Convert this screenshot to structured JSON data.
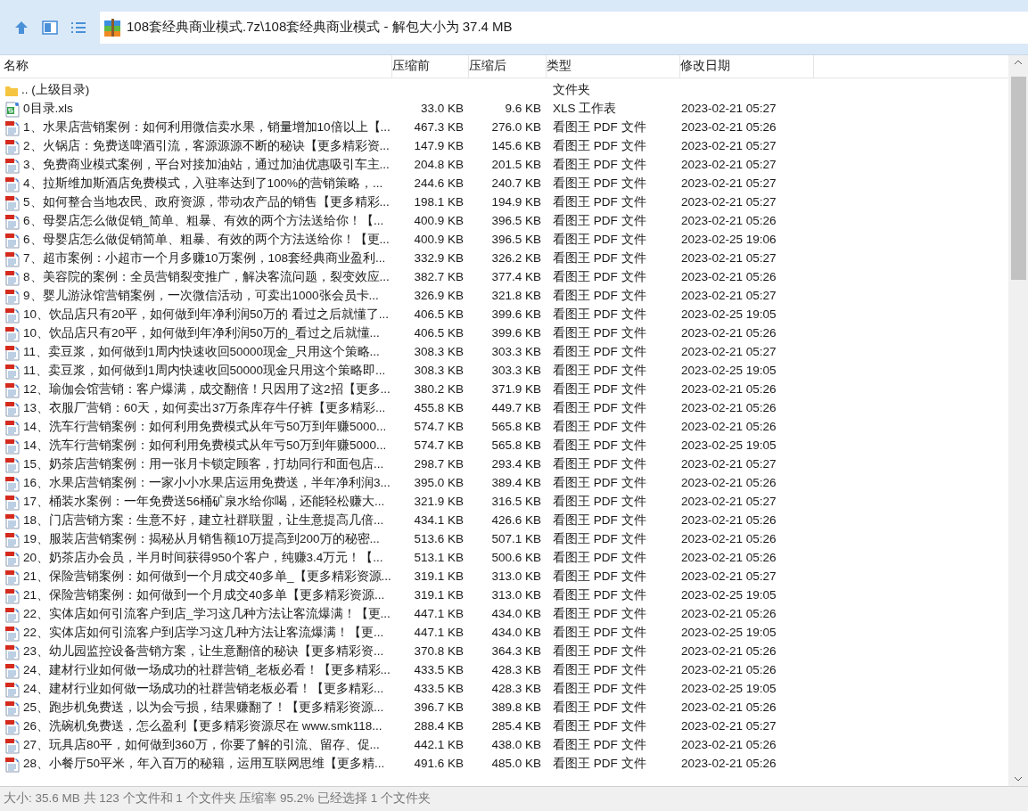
{
  "address": "108套经典商业模式.7z\\108套经典商业模式 - 解包大小为 37.4 MB",
  "columns": [
    "名称",
    "压缩前",
    "压缩后",
    "类型",
    "修改日期"
  ],
  "rows": [
    {
      "kind": "folder",
      "name": ".. (上级目录)",
      "before": "",
      "after": "",
      "type": "文件夹",
      "date": ""
    },
    {
      "kind": "xls",
      "name": "0目录.xls",
      "before": "33.0 KB",
      "after": "9.6 KB",
      "type": "XLS 工作表",
      "date": "2023-02-21 05:27"
    },
    {
      "kind": "pdf",
      "name": "1、水果店营销案例：如何利用微信卖水果，销量增加10倍以上【...",
      "before": "467.3 KB",
      "after": "276.0 KB",
      "type": "看图王 PDF 文件",
      "date": "2023-02-21 05:26"
    },
    {
      "kind": "pdf",
      "name": "2、火锅店：免费送啤酒引流，客源源源不断的秘诀【更多精彩资...",
      "before": "147.9 KB",
      "after": "145.6 KB",
      "type": "看图王 PDF 文件",
      "date": "2023-02-21 05:27"
    },
    {
      "kind": "pdf",
      "name": "3、免费商业模式案例，平台对接加油站，通过加油优惠吸引车主...",
      "before": "204.8 KB",
      "after": "201.5 KB",
      "type": "看图王 PDF 文件",
      "date": "2023-02-21 05:27"
    },
    {
      "kind": "pdf",
      "name": "4、拉斯维加斯酒店免费模式，入驻率达到了100%的营销策略，...",
      "before": "244.6 KB",
      "after": "240.7 KB",
      "type": "看图王 PDF 文件",
      "date": "2023-02-21 05:27"
    },
    {
      "kind": "pdf",
      "name": "5、如何整合当地农民、政府资源，带动农产品的销售【更多精彩...",
      "before": "198.1 KB",
      "after": "194.9 KB",
      "type": "看图王 PDF 文件",
      "date": "2023-02-21 05:27"
    },
    {
      "kind": "pdf",
      "name": "6、母婴店怎么做促销_简单、粗暴、有效的两个方法送给你！【...",
      "before": "400.9 KB",
      "after": "396.5 KB",
      "type": "看图王 PDF 文件",
      "date": "2023-02-21 05:26"
    },
    {
      "kind": "pdf",
      "name": "6、母婴店怎么做促销简单、粗暴、有效的两个方法送给你！【更...",
      "before": "400.9 KB",
      "after": "396.5 KB",
      "type": "看图王 PDF 文件",
      "date": "2023-02-25 19:06"
    },
    {
      "kind": "pdf",
      "name": "7、超市案例：小超市一个月多赚10万案例，108套经典商业盈利...",
      "before": "332.9 KB",
      "after": "326.2 KB",
      "type": "看图王 PDF 文件",
      "date": "2023-02-21 05:27"
    },
    {
      "kind": "pdf",
      "name": "8、美容院的案例：全员营销裂变推广，解决客流问题，裂变效应...",
      "before": "382.7 KB",
      "after": "377.4 KB",
      "type": "看图王 PDF 文件",
      "date": "2023-02-21 05:26"
    },
    {
      "kind": "pdf",
      "name": "9、婴儿游泳馆营销案例，一次微信活动，可卖出1000张会员卡...",
      "before": "326.9 KB",
      "after": "321.8 KB",
      "type": "看图王 PDF 文件",
      "date": "2023-02-21 05:27"
    },
    {
      "kind": "pdf",
      "name": "10、饮品店只有20平，如何做到年净利润50万的 看过之后就懂了...",
      "before": "406.5 KB",
      "after": "399.6 KB",
      "type": "看图王 PDF 文件",
      "date": "2023-02-25 19:05"
    },
    {
      "kind": "pdf",
      "name": "10、饮品店只有20平，如何做到年净利润50万的_看过之后就懂...",
      "before": "406.5 KB",
      "after": "399.6 KB",
      "type": "看图王 PDF 文件",
      "date": "2023-02-21 05:26"
    },
    {
      "kind": "pdf",
      "name": "11、卖豆浆，如何做到1周内快速收回50000现金_只用这个策略...",
      "before": "308.3 KB",
      "after": "303.3 KB",
      "type": "看图王 PDF 文件",
      "date": "2023-02-21 05:27"
    },
    {
      "kind": "pdf",
      "name": "11、卖豆浆，如何做到1周内快速收回50000现金只用这个策略即...",
      "before": "308.3 KB",
      "after": "303.3 KB",
      "type": "看图王 PDF 文件",
      "date": "2023-02-25 19:05"
    },
    {
      "kind": "pdf",
      "name": "12、瑜伽会馆营销：客户爆满，成交翻倍！只因用了这2招【更多...",
      "before": "380.2 KB",
      "after": "371.9 KB",
      "type": "看图王 PDF 文件",
      "date": "2023-02-21 05:26"
    },
    {
      "kind": "pdf",
      "name": "13、衣服厂营销：60天，如何卖出37万条库存牛仔裤【更多精彩...",
      "before": "455.8 KB",
      "after": "449.7 KB",
      "type": "看图王 PDF 文件",
      "date": "2023-02-21 05:26"
    },
    {
      "kind": "pdf",
      "name": "14、洗车行营销案例：如何利用免费模式从年亏50万到年赚5000...",
      "before": "574.7 KB",
      "after": "565.8 KB",
      "type": "看图王 PDF 文件",
      "date": "2023-02-21 05:26"
    },
    {
      "kind": "pdf",
      "name": "14、洗车行营销案例：如何利用免费模式从年亏50万到年赚5000...",
      "before": "574.7 KB",
      "after": "565.8 KB",
      "type": "看图王 PDF 文件",
      "date": "2023-02-25 19:05"
    },
    {
      "kind": "pdf",
      "name": "15、奶茶店营销案例：用一张月卡锁定顾客，打劫同行和面包店...",
      "before": "298.7 KB",
      "after": "293.4 KB",
      "type": "看图王 PDF 文件",
      "date": "2023-02-21 05:27"
    },
    {
      "kind": "pdf",
      "name": "16、水果店营销案例：一家小小水果店运用免费送，半年净利润3...",
      "before": "395.0 KB",
      "after": "389.4 KB",
      "type": "看图王 PDF 文件",
      "date": "2023-02-21 05:26"
    },
    {
      "kind": "pdf",
      "name": "17、桶装水案例：一年免费送56桶矿泉水给你喝，还能轻松赚大...",
      "before": "321.9 KB",
      "after": "316.5 KB",
      "type": "看图王 PDF 文件",
      "date": "2023-02-21 05:27"
    },
    {
      "kind": "pdf",
      "name": "18、门店营销方案：生意不好，建立社群联盟，让生意提高几倍...",
      "before": "434.1 KB",
      "after": "426.6 KB",
      "type": "看图王 PDF 文件",
      "date": "2023-02-21 05:26"
    },
    {
      "kind": "pdf",
      "name": "19、服装店营销案例：揭秘从月销售额10万提高到200万的秘密...",
      "before": "513.6 KB",
      "after": "507.1 KB",
      "type": "看图王 PDF 文件",
      "date": "2023-02-21 05:26"
    },
    {
      "kind": "pdf",
      "name": "20、奶茶店办会员，半月时间获得950个客户，纯赚3.4万元！【...",
      "before": "513.1 KB",
      "after": "500.6 KB",
      "type": "看图王 PDF 文件",
      "date": "2023-02-21 05:26"
    },
    {
      "kind": "pdf",
      "name": "21、保险营销案例：如何做到一个月成交40多单_【更多精彩资源...",
      "before": "319.1 KB",
      "after": "313.0 KB",
      "type": "看图王 PDF 文件",
      "date": "2023-02-21 05:27"
    },
    {
      "kind": "pdf",
      "name": "21、保险营销案例：如何做到一个月成交40多单【更多精彩资源...",
      "before": "319.1 KB",
      "after": "313.0 KB",
      "type": "看图王 PDF 文件",
      "date": "2023-02-25 19:05"
    },
    {
      "kind": "pdf",
      "name": "22、实体店如何引流客户到店_学习这几种方法让客流爆满！【更...",
      "before": "447.1 KB",
      "after": "434.0 KB",
      "type": "看图王 PDF 文件",
      "date": "2023-02-21 05:26"
    },
    {
      "kind": "pdf",
      "name": "22、实体店如何引流客户到店学习这几种方法让客流爆满！【更...",
      "before": "447.1 KB",
      "after": "434.0 KB",
      "type": "看图王 PDF 文件",
      "date": "2023-02-25 19:05"
    },
    {
      "kind": "pdf",
      "name": "23、幼儿园监控设备营销方案，让生意翻倍的秘诀【更多精彩资...",
      "before": "370.8 KB",
      "after": "364.3 KB",
      "type": "看图王 PDF 文件",
      "date": "2023-02-21 05:26"
    },
    {
      "kind": "pdf",
      "name": "24、建材行业如何做一场成功的社群营销_老板必看！【更多精彩...",
      "before": "433.5 KB",
      "after": "428.3 KB",
      "type": "看图王 PDF 文件",
      "date": "2023-02-21 05:26"
    },
    {
      "kind": "pdf",
      "name": "24、建材行业如何做一场成功的社群营销老板必看！【更多精彩...",
      "before": "433.5 KB",
      "after": "428.3 KB",
      "type": "看图王 PDF 文件",
      "date": "2023-02-25 19:05"
    },
    {
      "kind": "pdf",
      "name": "25、跑步机免费送，以为会亏损，结果赚翻了！【更多精彩资源...",
      "before": "396.7 KB",
      "after": "389.8 KB",
      "type": "看图王 PDF 文件",
      "date": "2023-02-21 05:26"
    },
    {
      "kind": "pdf",
      "name": "26、洗碗机免费送，怎么盈利【更多精彩资源尽在 www.smk118...",
      "before": "288.4 KB",
      "after": "285.4 KB",
      "type": "看图王 PDF 文件",
      "date": "2023-02-21 05:27"
    },
    {
      "kind": "pdf",
      "name": "27、玩具店80平，如何做到360万，你要了解的引流、留存、促...",
      "before": "442.1 KB",
      "after": "438.0 KB",
      "type": "看图王 PDF 文件",
      "date": "2023-02-21 05:26"
    },
    {
      "kind": "pdf",
      "name": "28、小餐厅50平米，年入百万的秘籍，运用互联网思维【更多精...",
      "before": "491.6 KB",
      "after": "485.0 KB",
      "type": "看图王 PDF 文件",
      "date": "2023-02-21 05:26"
    }
  ],
  "status": "大小: 35.6 MB 共 123 个文件和 1 个文件夹 压缩率 95.2% 已经选择 1 个文件夹"
}
